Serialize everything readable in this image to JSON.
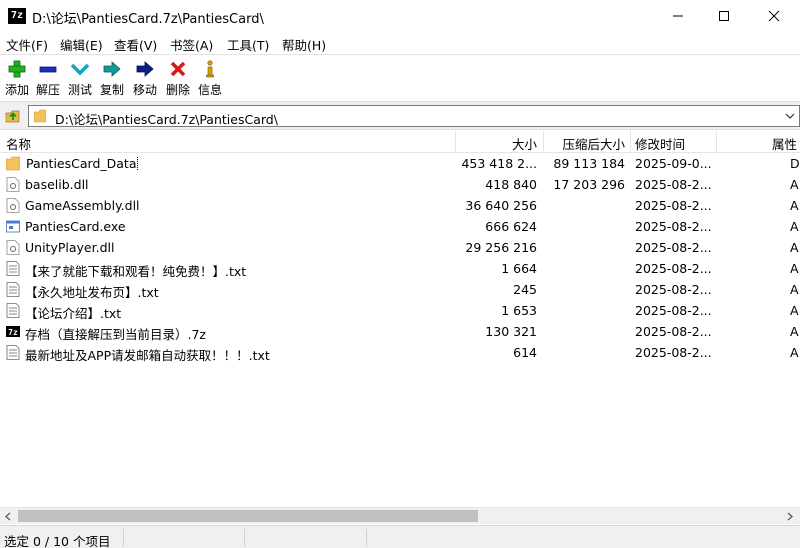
{
  "window": {
    "app_icon_text": "7z",
    "title": "D:\\论坛\\PantiesCard.7z\\PantiesCard\\"
  },
  "menu": [
    {
      "label": "文件(F)"
    },
    {
      "label": "编辑(E)"
    },
    {
      "label": "查看(V)"
    },
    {
      "label": "书签(A)"
    },
    {
      "label": "工具(T)"
    },
    {
      "label": "帮助(H)"
    }
  ],
  "toolbar": [
    {
      "label": "添加",
      "icon": "add-icon",
      "color": "#1fb41f"
    },
    {
      "label": "解压",
      "icon": "extract-icon",
      "color": "#1c2fb8"
    },
    {
      "label": "测试",
      "icon": "test-icon",
      "color": "#13a3c0"
    },
    {
      "label": "复制",
      "icon": "copy-icon",
      "color": "#139a96"
    },
    {
      "label": "移动",
      "icon": "move-icon",
      "color": "#0b1f86"
    },
    {
      "label": "删除",
      "icon": "delete-icon",
      "color": "#d41b1b"
    },
    {
      "label": "信息",
      "icon": "info-icon",
      "color": "#d6a500"
    }
  ],
  "address": {
    "path": "D:\\论坛\\PantiesCard.7z\\PantiesCard\\"
  },
  "columns": {
    "name": "名称",
    "size": "大小",
    "packed": "压缩后大小",
    "modified": "修改时间",
    "attributes": "属性"
  },
  "files": [
    {
      "name": "PantiesCard_Data",
      "size": "453 418 2...",
      "packed": "89 113 184",
      "modified": "2025-09-0...",
      "attr": "D",
      "type": "folder"
    },
    {
      "name": "baselib.dll",
      "size": "418 840",
      "packed": "17 203 296",
      "modified": "2025-08-2...",
      "attr": "A",
      "type": "dll"
    },
    {
      "name": "GameAssembly.dll",
      "size": "36 640 256",
      "packed": "",
      "modified": "2025-08-2...",
      "attr": "A",
      "type": "dll"
    },
    {
      "name": "PantiesCard.exe",
      "size": "666 624",
      "packed": "",
      "modified": "2025-08-2...",
      "attr": "A",
      "type": "exe"
    },
    {
      "name": "UnityPlayer.dll",
      "size": "29 256 216",
      "packed": "",
      "modified": "2025-08-2...",
      "attr": "A",
      "type": "dll"
    },
    {
      "name": "【来了就能下载和观看！纯免费！】.txt",
      "size": "1 664",
      "packed": "",
      "modified": "2025-08-2...",
      "attr": "A",
      "type": "txt"
    },
    {
      "name": "【永久地址发布页】.txt",
      "size": "245",
      "packed": "",
      "modified": "2025-08-2...",
      "attr": "A",
      "type": "txt"
    },
    {
      "name": "【论坛介绍】.txt",
      "size": "1 653",
      "packed": "",
      "modified": "2025-08-2...",
      "attr": "A",
      "type": "txt"
    },
    {
      "name": "存档（直接解压到当前目录）.7z",
      "size": "130 321",
      "packed": "",
      "modified": "2025-08-2...",
      "attr": "A",
      "type": "7z"
    },
    {
      "name": "最新地址及APP请发邮箱自动获取！！！.txt",
      "size": "614",
      "packed": "",
      "modified": "2025-08-2...",
      "attr": "A",
      "type": "txt"
    }
  ],
  "status": {
    "selection": "选定 0 / 10 个项目"
  }
}
